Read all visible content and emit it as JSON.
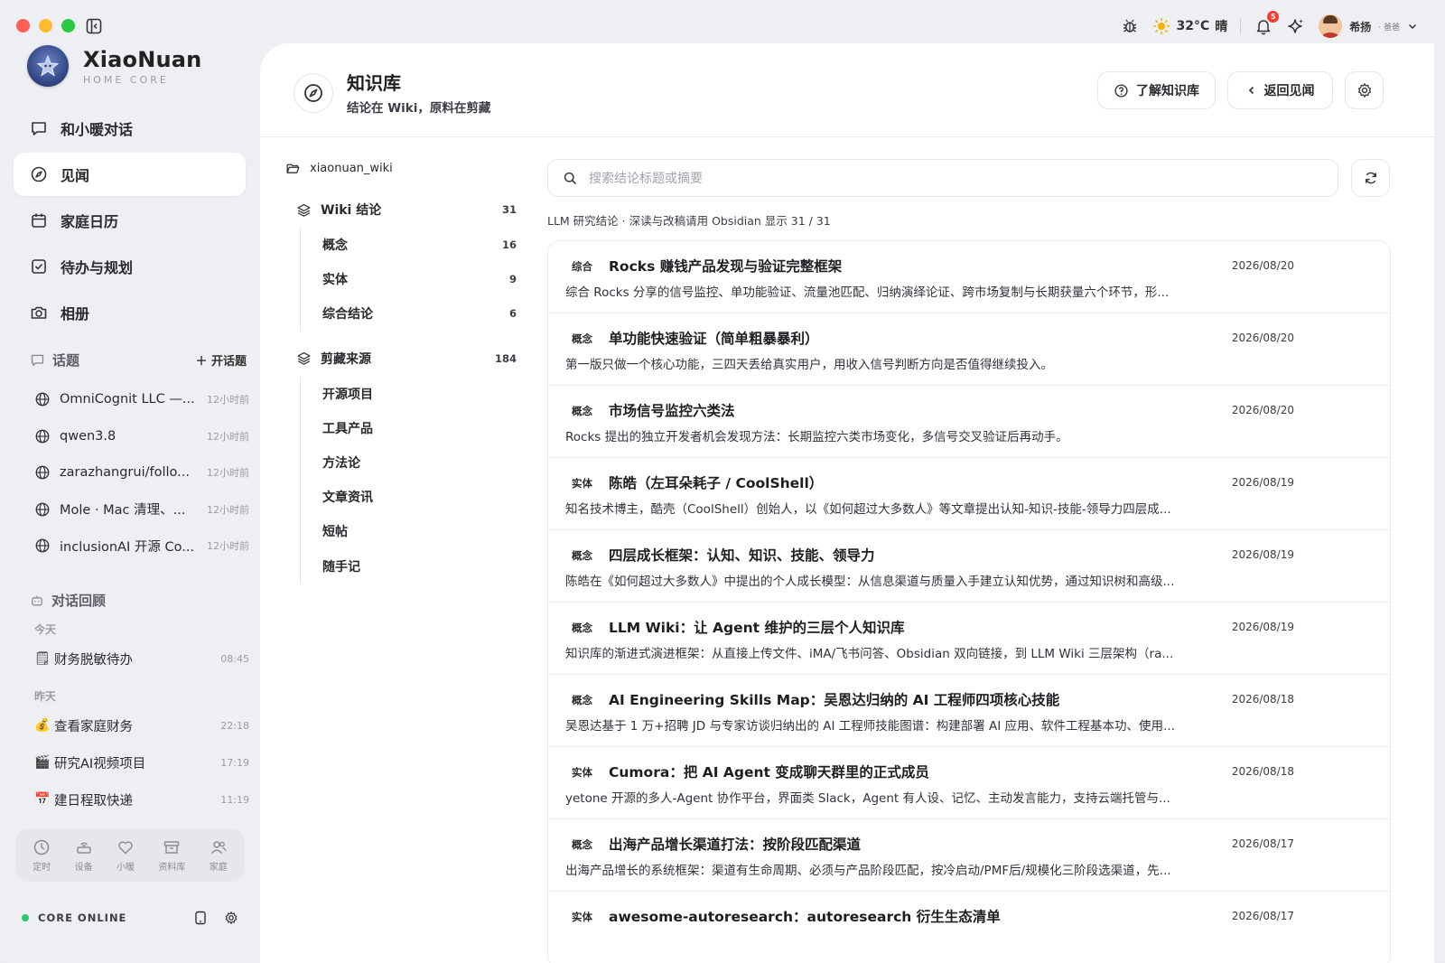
{
  "app": {
    "brand_name": "XiaoNuan",
    "brand_sub": "HOME CORE"
  },
  "topbar": {
    "weather_temp": "32°C",
    "weather_desc": "晴",
    "notifications_count": "5",
    "user_name": "希扬",
    "user_role": "· 爸爸"
  },
  "nav": {
    "items": [
      {
        "label": "和小暖对话",
        "icon": "chat-icon"
      },
      {
        "label": "见闻",
        "icon": "compass-icon"
      },
      {
        "label": "家庭日历",
        "icon": "calendar-icon"
      },
      {
        "label": "待办与规划",
        "icon": "checkbox-icon"
      },
      {
        "label": "相册",
        "icon": "camera-icon"
      }
    ]
  },
  "topics": {
    "title": "话题",
    "add_label": "开话题",
    "items": [
      {
        "title": "OmniCognit LLC —...",
        "time": "12小时前"
      },
      {
        "title": "qwen3.8",
        "time": "12小时前"
      },
      {
        "title": "zarazhangrui/follo...",
        "time": "12小时前"
      },
      {
        "title": "Mole · Mac 清理、...",
        "time": "12小时前"
      },
      {
        "title": "inclusionAI 开源 Co...",
        "time": "12小时前"
      }
    ]
  },
  "recap": {
    "title": "对话回顾",
    "today_label": "今天",
    "yesterday_label": "昨天",
    "today": [
      {
        "emoji": "🗒",
        "title": "财务脱敏待办",
        "time": "08:45"
      }
    ],
    "yesterday": [
      {
        "emoji": "💰",
        "title": "查看家庭财务",
        "time": "22:18"
      },
      {
        "emoji": "🎬",
        "title": "研究AI视频项目",
        "time": "17:19"
      },
      {
        "emoji": "📅",
        "title": "建日程取快递",
        "time": "11:19"
      }
    ]
  },
  "dock": {
    "items": [
      {
        "label": "定时",
        "icon": "clock-icon"
      },
      {
        "label": "设备",
        "icon": "device-icon"
      },
      {
        "label": "小暖",
        "icon": "heart-icon"
      },
      {
        "label": "资料库",
        "icon": "archive-icon"
      },
      {
        "label": "家庭",
        "icon": "family-icon"
      }
    ]
  },
  "status": {
    "label": "CORE ONLINE",
    "color": "#2ec46b"
  },
  "header": {
    "title": "知识库",
    "subtitle": "结论在 Wiki，原料在剪藏",
    "learn_label": "了解知识库",
    "back_label": "返回见闻"
  },
  "tree": {
    "root": "xiaonuan_wiki",
    "groups": [
      {
        "label": "Wiki 结论",
        "count": "31",
        "children": [
          {
            "label": "概念",
            "count": "16"
          },
          {
            "label": "实体",
            "count": "9"
          },
          {
            "label": "综合结论",
            "count": "6"
          }
        ]
      },
      {
        "label": "剪藏来源",
        "count": "184",
        "children": [
          {
            "label": "开源项目",
            "count": ""
          },
          {
            "label": "工具产品",
            "count": ""
          },
          {
            "label": "方法论",
            "count": ""
          },
          {
            "label": "文章资讯",
            "count": ""
          },
          {
            "label": "短帖",
            "count": ""
          },
          {
            "label": "随手记",
            "count": ""
          }
        ]
      }
    ]
  },
  "search": {
    "placeholder": "搜索结论标题或摘要"
  },
  "meta": {
    "text": "LLM 研究结论 · 深读与改稿请用 Obsidian   显示 31 / 31"
  },
  "entries": [
    {
      "tag": "综合",
      "title": "Rocks 赚钱产品发现与验证完整框架",
      "date": "2026/08/20",
      "summary": "综合 Rocks 分享的信号监控、单功能验证、流量池匹配、归纳演绎论证、跨市场复制与长期获量六个环节，形..."
    },
    {
      "tag": "概念",
      "title": "单功能快速验证（简单粗暴暴利）",
      "date": "2026/08/20",
      "summary": "第一版只做一个核心功能，三四天丢给真实用户，用收入信号判断方向是否值得继续投入。"
    },
    {
      "tag": "概念",
      "title": "市场信号监控六类法",
      "date": "2026/08/20",
      "summary": "Rocks 提出的独立开发者机会发现方法：长期监控六类市场变化，多信号交叉验证后再动手。"
    },
    {
      "tag": "实体",
      "title": "陈皓（左耳朵耗子 / CoolShell）",
      "date": "2026/08/19",
      "summary": "知名技术博主，酷壳（CoolShell）创始人，以《如何超过大多数人》等文章提出认知-知识-技能-领导力四层成..."
    },
    {
      "tag": "概念",
      "title": "四层成长框架：认知、知识、技能、领导力",
      "date": "2026/08/19",
      "summary": "陈皓在《如何超过大多数人》中提出的个人成长模型：从信息渠道与质量入手建立认知优势，通过知识树和高级..."
    },
    {
      "tag": "概念",
      "title": "LLM Wiki：让 Agent 维护的三层个人知识库",
      "date": "2026/08/19",
      "summary": "知识库的渐进式演进框架：从直接上传文件、iMA/飞书问答、Obsidian 双向链接，到 LLM Wiki 三层架构（ra..."
    },
    {
      "tag": "概念",
      "title": "AI Engineering Skills Map：吴恩达归纳的 AI 工程师四项核心技能",
      "date": "2026/08/18",
      "summary": "吴恩达基于 1 万+招聘 JD 与专家访谈归纳出的 AI 工程师技能图谱：构建部署 AI 应用、软件工程基本功、使用..."
    },
    {
      "tag": "实体",
      "title": "Cumora：把 AI Agent 变成聊天群里的正式成员",
      "date": "2026/08/18",
      "summary": "yetone 开源的多人-Agent 协作平台，界面类 Slack，Agent 有人设、记忆、主动发言能力，支持云端托管与..."
    },
    {
      "tag": "概念",
      "title": "出海产品增长渠道打法：按阶段匹配渠道",
      "date": "2026/08/17",
      "summary": "出海产品增长的系统框架：渠道有生命周期、必须与产品阶段匹配，按冷启动/PMF后/规模化三阶段选渠道，先..."
    },
    {
      "tag": "实体",
      "title": "awesome-autoresearch：autoresearch 衍生生态清单",
      "date": "2026/08/17",
      "summary": ""
    }
  ]
}
